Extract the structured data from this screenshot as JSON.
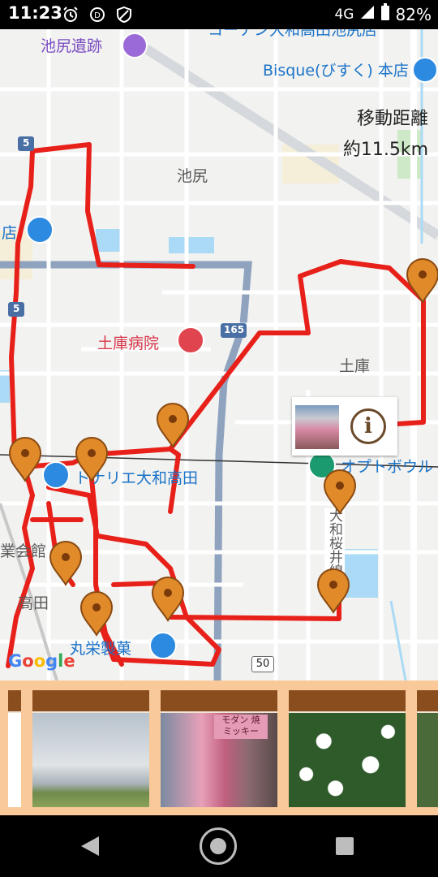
{
  "status_bar": {
    "time": "11:23",
    "network": "4G",
    "battery": "82%",
    "icons": [
      "alarm-icon",
      "data-saver-icon",
      "shield-icon",
      "signal-icon",
      "battery-icon"
    ]
  },
  "map": {
    "labels": {
      "ikejiri_iseki": "池尻遺跡",
      "bisque": "Bisque(びすく) 本店",
      "ikejiri": "池尻",
      "store_partial": "店",
      "tsuchiko_hospital": "土庫病院",
      "tsuchiko": "土庫",
      "tonarie": "トナリエ大和高田",
      "optbowl": "オプトボウル",
      "kaikan": "業会館",
      "takada": "高田",
      "maruei": "丸栄製菓",
      "sakurai_line": "大和桜井線",
      "top_partial": "コーナン大和高田池尻店"
    },
    "road_badges": {
      "r5_top": "5",
      "r5_mid": "5",
      "r165": "165",
      "r50": "50"
    },
    "distance": {
      "label": "移動距離",
      "value": "約11.5km"
    },
    "route_color": "#e8201a",
    "marker_color": "#e08a2a",
    "google_logo": "Google"
  },
  "info_button": {
    "icon": "info-icon",
    "label": "i"
  },
  "photo_strip": {
    "cards": [
      {
        "name": "photo-card-partial-left"
      },
      {
        "name": "photo-card-sky"
      },
      {
        "name": "photo-card-shop"
      },
      {
        "name": "photo-card-flowers"
      },
      {
        "name": "photo-card-partial-right"
      }
    ],
    "shop_sign": "モダン 焼\nミッキー"
  },
  "nav": {
    "back": "back-icon",
    "home": "home-icon",
    "recent": "recent-apps-icon"
  }
}
